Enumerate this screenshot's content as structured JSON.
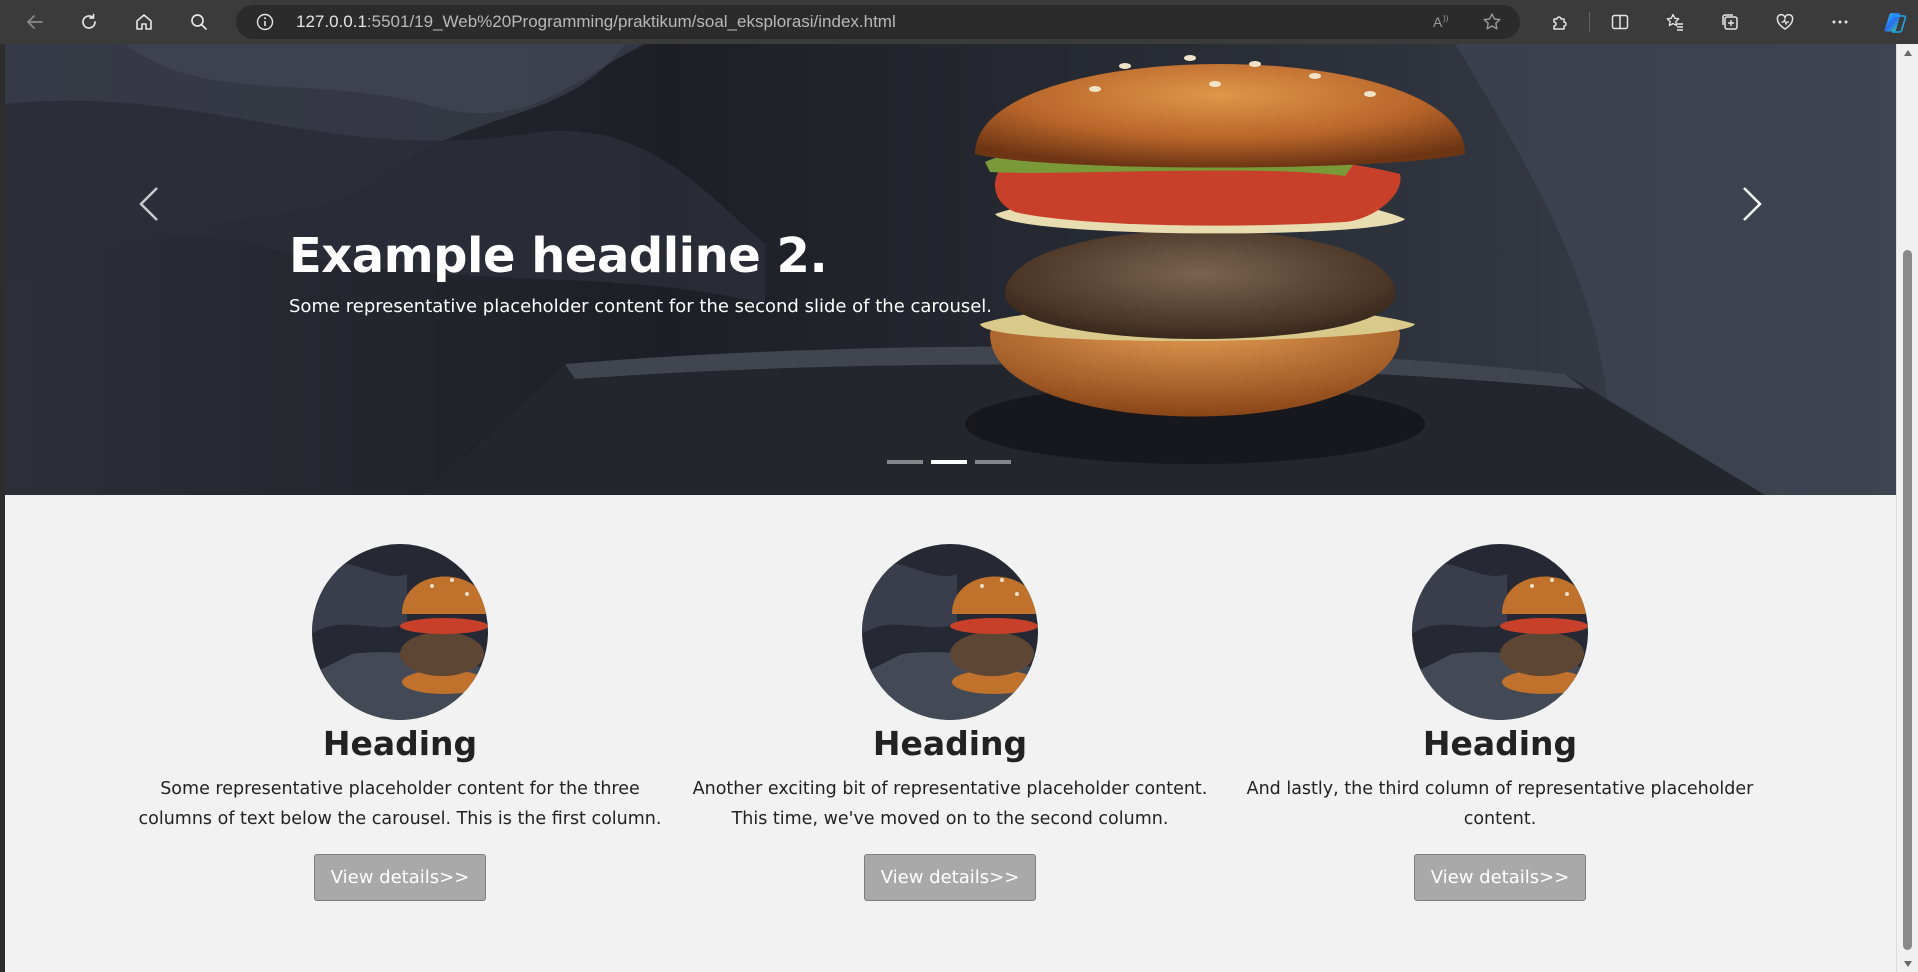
{
  "browser": {
    "url_host": "127.0.0.1",
    "url_path": ":5501/19_Web%20Programming/praktikum/soal_eksplorasi/index.html",
    "icons": [
      "back-icon",
      "refresh-icon",
      "home-icon",
      "search-icon",
      "info-icon",
      "read-aloud-icon",
      "favorite-star-icon",
      "extensions-icon",
      "split-screen-icon",
      "favorites-icon",
      "collections-icon",
      "browser-essentials-icon",
      "more-icon",
      "copilot-icon"
    ]
  },
  "carousel": {
    "headline": "Example headline 2.",
    "text": "Some representative placeholder content for the second slide of the carousel.",
    "slide_count": 3,
    "active_slide": 2
  },
  "columns": [
    {
      "heading": "Heading",
      "text": "Some representative placeholder content for the three columns of text below the carousel. This is the first column.",
      "button": "View details>>"
    },
    {
      "heading": "Heading",
      "text": "Another exciting bit of representative placeholder content. This time, we've moved on to the second column.",
      "button": "View details>>"
    },
    {
      "heading": "Heading",
      "text": "And lastly, the third column of representative placeholder content.",
      "button": "View details>>"
    }
  ],
  "colors": {
    "chrome": "#3b3b3b",
    "address_bar": "#2b2b2b",
    "page_background": "#f2f2f2",
    "button": "#a9a9a9"
  }
}
